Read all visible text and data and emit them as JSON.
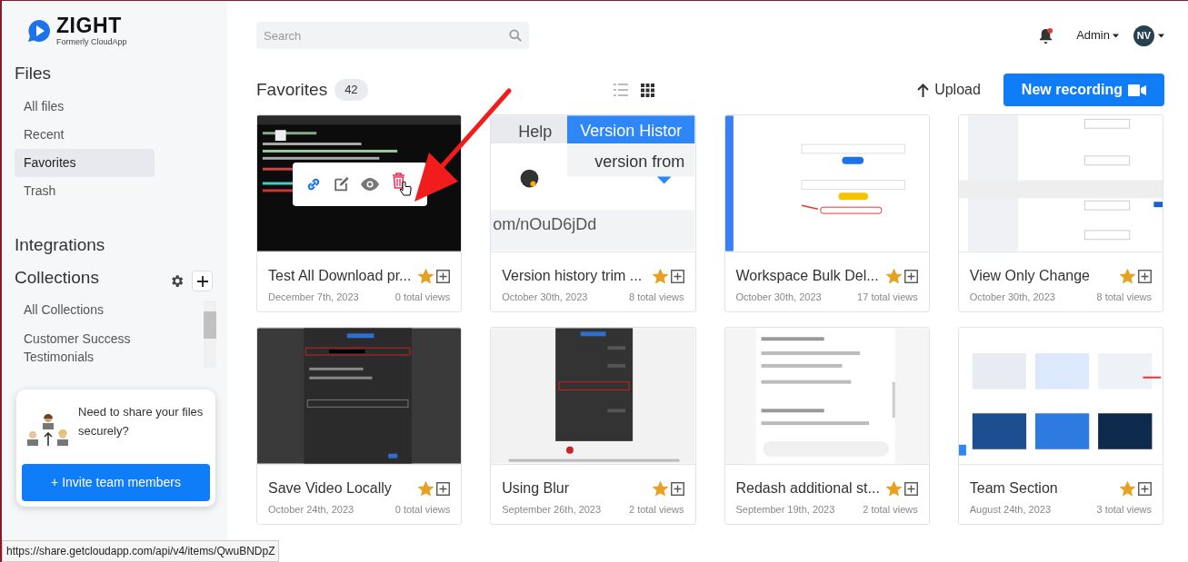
{
  "brand": {
    "name": "ZIGHT",
    "tagline": "Formerly CloudApp"
  },
  "sidebar": {
    "files_heading": "Files",
    "items": [
      {
        "label": "All files",
        "selected": false
      },
      {
        "label": "Recent",
        "selected": false
      },
      {
        "label": "Favorites",
        "selected": true
      },
      {
        "label": "Trash",
        "selected": false
      }
    ],
    "integrations_heading": "Integrations",
    "collections_heading": "Collections",
    "collections": [
      {
        "label": "All Collections"
      },
      {
        "label": "Customer Success Testimonials"
      }
    ],
    "promo": {
      "text": "Need to share your files securely?",
      "button": "+ Invite team members"
    }
  },
  "header": {
    "search": {
      "placeholder": "Search"
    },
    "notification_dot": true,
    "admin_menu": "Admin",
    "avatar": "NV"
  },
  "toolbar": {
    "title": "Favorites",
    "count": "42",
    "views": [
      {
        "kind": "list",
        "selected": false
      },
      {
        "kind": "grid",
        "selected": true
      }
    ],
    "upload": "Upload",
    "new_recording": "New recording"
  },
  "cards": [
    {
      "title": "Test All Download pr...",
      "date": "December 7th, 2023",
      "views": "0 total views",
      "kind": "terminal",
      "hover": true,
      "favorite": true
    },
    {
      "title": "Version history trim ...",
      "date": "October 30th, 2023",
      "views": "8 total views",
      "kind": "browser",
      "favorite": true,
      "thumb_texts": [
        "Help",
        "Version Histor",
        "version from",
        "om/nOuD6jDd"
      ]
    },
    {
      "title": "Workspace Bulk Del...",
      "date": "October 30th, 2023",
      "views": "17 total views",
      "kind": "form",
      "favorite": true
    },
    {
      "title": "View Only Change",
      "date": "October 30th, 2023",
      "views": "8 total views",
      "kind": "table",
      "favorite": true
    },
    {
      "title": "Save Video Locally",
      "date": "October 24th, 2023",
      "views": "0 total views",
      "kind": "settings",
      "favorite": true
    },
    {
      "title": "Using Blur",
      "date": "September 26th, 2023",
      "views": "2 total views",
      "kind": "editor",
      "favorite": true
    },
    {
      "title": "Redash additional st...",
      "date": "September 19th, 2023",
      "views": "2 total views",
      "kind": "chat",
      "favorite": true
    },
    {
      "title": "Team Section",
      "date": "August 24th, 2023",
      "views": "3 total views",
      "kind": "gallery",
      "favorite": true
    }
  ],
  "status_url": "https://share.getcloudapp.com/api/v4/items/QwuBNDpZ"
}
